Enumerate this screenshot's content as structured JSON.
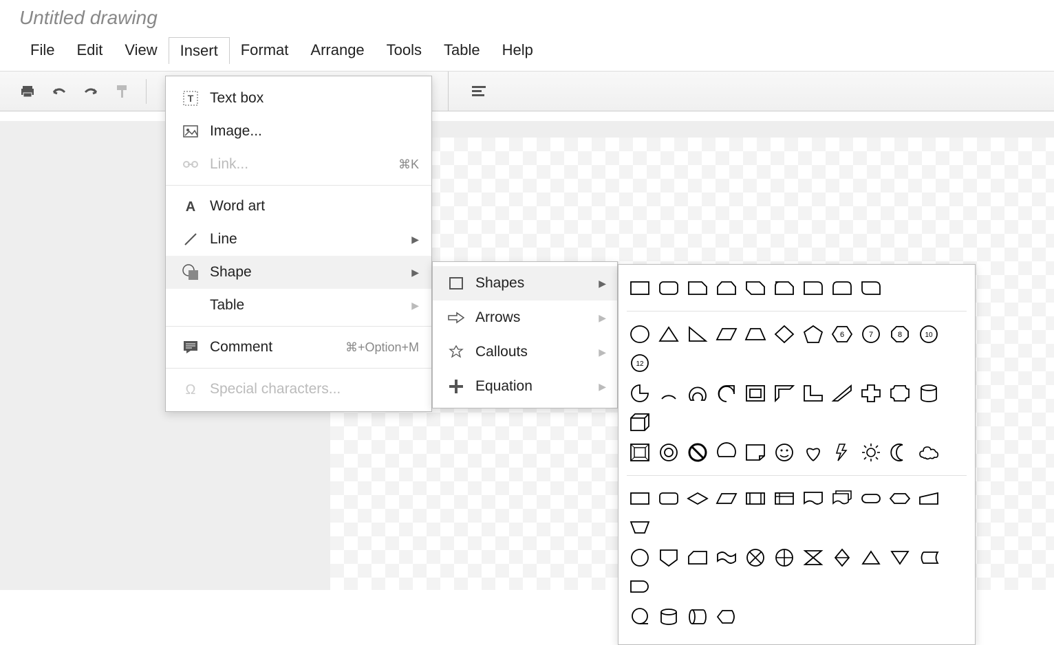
{
  "title": "Untitled drawing",
  "menubar": [
    "File",
    "Edit",
    "View",
    "Insert",
    "Format",
    "Arrange",
    "Tools",
    "Table",
    "Help"
  ],
  "menubar_active": "Insert",
  "insert_menu": {
    "textbox": "Text box",
    "image": "Image...",
    "link": "Link...",
    "link_shortcut": "⌘K",
    "wordart": "Word art",
    "line": "Line",
    "shape": "Shape",
    "table": "Table",
    "comment": "Comment",
    "comment_shortcut": "⌘+Option+M",
    "special": "Special characters..."
  },
  "shape_submenu": {
    "shapes": "Shapes",
    "arrows": "Arrows",
    "callouts": "Callouts",
    "equation": "Equation"
  },
  "shapes_grid": {
    "row1": [
      "rect",
      "rounded-rect",
      "snip-single",
      "snip-same",
      "snip-diag",
      "snip-round",
      "round-single",
      "round-same",
      "round-diag"
    ],
    "row2": [
      "circle",
      "triangle",
      "right-triangle",
      "parallelogram",
      "trapezoid",
      "diamond",
      "pentagon",
      "hexagon-6",
      "heptagon-7",
      "octagon-8",
      "decagon-10",
      "dodecagon-12"
    ],
    "row3": [
      "pie",
      "arc",
      "block-arc",
      "teardrop",
      "frame",
      "half-frame",
      "l-shape",
      "diag-stripe",
      "cross",
      "plaque",
      "can",
      "cube"
    ],
    "row4": [
      "bevel",
      "donut",
      "no-symbol",
      "chord",
      "folded-corner",
      "smiley",
      "heart",
      "lightning",
      "sun",
      "moon",
      "cloud"
    ],
    "row5": [
      "flow-process",
      "flow-alt-process",
      "flow-decision",
      "flow-data",
      "flow-predef",
      "flow-internal",
      "flow-document",
      "flow-multidoc",
      "flow-terminator",
      "flow-prep",
      "flow-manual-input",
      "flow-manual-op"
    ],
    "row6": [
      "flow-connector",
      "flow-offpage",
      "flow-card",
      "flow-tape",
      "summing",
      "or",
      "collate",
      "sort",
      "extract",
      "merge",
      "stored",
      "delay"
    ],
    "row7": [
      "seq-access",
      "magnetic-disk",
      "direct-access",
      "display"
    ]
  }
}
